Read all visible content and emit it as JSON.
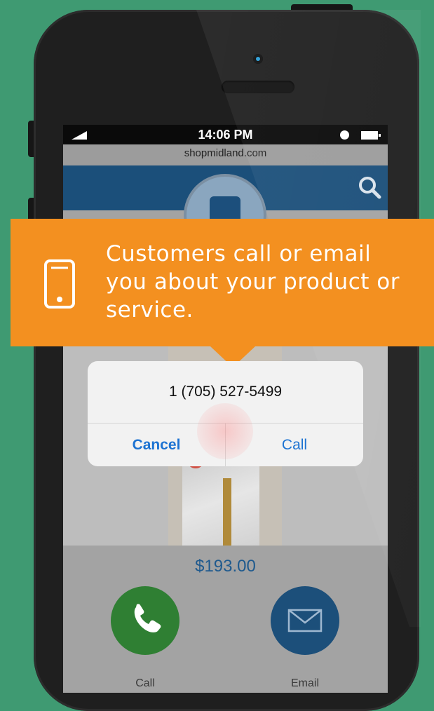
{
  "status_bar": {
    "time": "14:06 PM",
    "icons": [
      "signal-icon",
      "alarm-icon",
      "battery-icon"
    ]
  },
  "browser": {
    "url": "shopmidland.com"
  },
  "site": {
    "header_color": "#1b4f7a",
    "search_icon": "search-icon",
    "logo_icon": "storefront-logo-icon"
  },
  "banner": {
    "text": "Customers call or email you about your product or service.",
    "icon": "smartphone-icon",
    "color": "#f39020"
  },
  "call_dialog": {
    "phone_number": "1 (705) 527-5499",
    "cancel_label": "Cancel",
    "call_label": "Call"
  },
  "product": {
    "price": "$193.00"
  },
  "actions": {
    "call_label": "Call",
    "email_label": "Email",
    "call_icon": "phone-icon",
    "email_icon": "envelope-icon",
    "call_color": "#2f7f33",
    "email_color": "#1c4f7a"
  }
}
